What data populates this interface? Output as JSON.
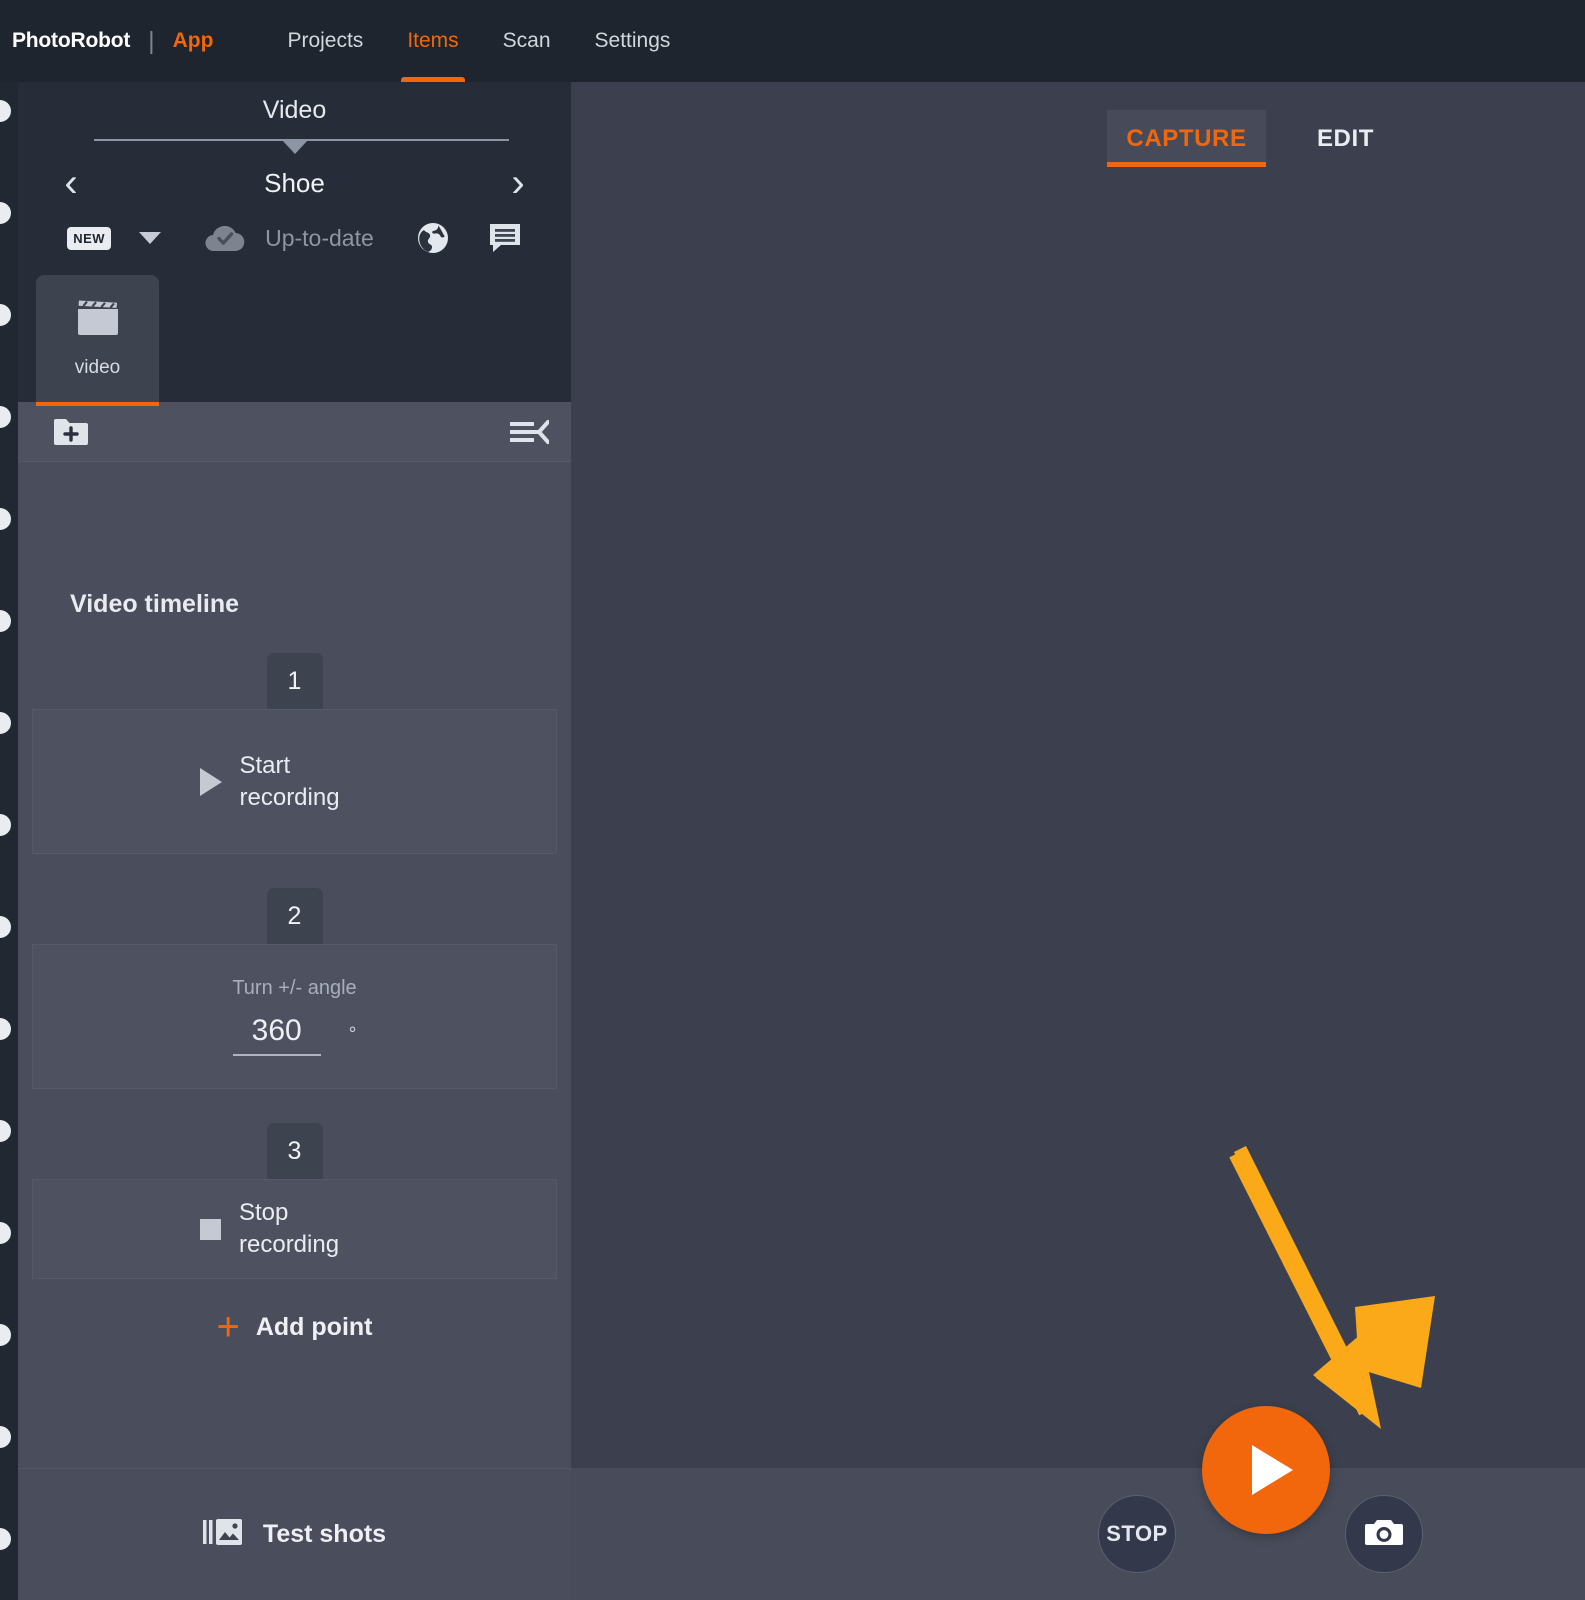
{
  "topnav": {
    "brand": "PhotoRobot",
    "separator": "|",
    "app_label": "App",
    "links": [
      {
        "label": "Projects",
        "active": false
      },
      {
        "label": "Items",
        "active": true
      },
      {
        "label": "Scan",
        "active": false
      },
      {
        "label": "Settings",
        "active": false
      }
    ]
  },
  "sidebar": {
    "title": "Video",
    "item_name": "Shoe",
    "prev_arrow": "‹",
    "next_arrow": "›",
    "badge": "NEW",
    "sync_status": "Up-to-date",
    "tabs": [
      {
        "label": "video",
        "icon": "clapperboard-icon",
        "active": true
      }
    ],
    "timeline_title": "Video timeline",
    "steps": [
      {
        "number": "1",
        "label": "Start recording",
        "icon": "play-icon",
        "type": "action"
      },
      {
        "number": "2",
        "field_label": "Turn +/- angle",
        "value": "360",
        "unit": "°",
        "type": "field"
      },
      {
        "number": "3",
        "label": "Stop recording",
        "icon": "stop-icon",
        "type": "action"
      }
    ],
    "add_point_label": "Add point",
    "add_point_icon": "plus-icon",
    "test_shots_label": "Test shots",
    "test_shots_icon": "burst-gallery-icon"
  },
  "main": {
    "tabs": [
      {
        "label": "CAPTURE",
        "active": true
      },
      {
        "label": "EDIT",
        "active": false
      }
    ],
    "controls": {
      "stop_label": "STOP",
      "play_icon": "play-icon",
      "camera_icon": "camera-icon"
    }
  },
  "colors": {
    "accent_orange": "#f2670c",
    "annotation_amber": "#FBA919",
    "topnav_bg": "#1e252e",
    "sidebar_header_bg": "#262d38",
    "sidebar_bg": "#494d5c",
    "viewport_bg": "#3c404e",
    "bottombar_bg": "#484c5a",
    "card_bg": "#4e5260"
  }
}
